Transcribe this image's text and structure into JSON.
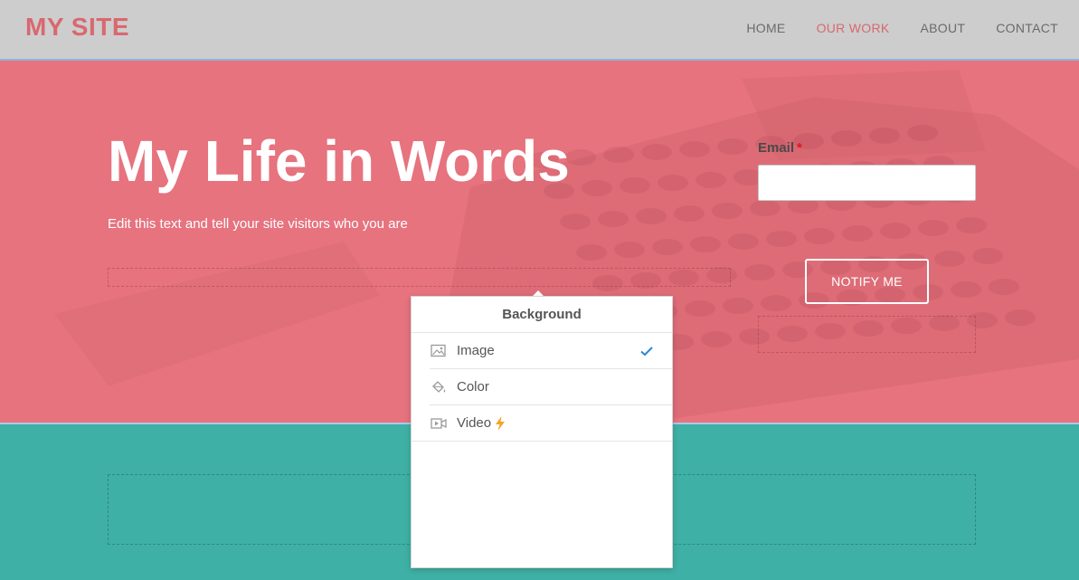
{
  "site": {
    "logo": "MY SITE"
  },
  "nav": {
    "items": [
      {
        "label": "HOME",
        "active": false
      },
      {
        "label": "OUR WORK",
        "active": true
      },
      {
        "label": "ABOUT",
        "active": false
      },
      {
        "label": "CONTACT",
        "active": false
      }
    ]
  },
  "hero": {
    "title": "My Life in Words",
    "subtitle": "Edit this text and tell your site visitors who you are",
    "background_color": "#e6737e"
  },
  "form": {
    "email_label": "Email",
    "required_mark": "*",
    "email_value": "",
    "button_label": "NOTIFY ME"
  },
  "background_menu": {
    "title": "Background",
    "options": [
      {
        "label": "Image",
        "icon": "image-icon",
        "selected": true
      },
      {
        "label": "Color",
        "icon": "paint-bucket-icon",
        "selected": false
      },
      {
        "label": "Video",
        "icon": "video-icon",
        "selected": false,
        "badge": "lightning-icon"
      }
    ]
  },
  "colors": {
    "accent": "#d9686f",
    "teal": "#3fb0a5",
    "check": "#2b87d1",
    "bolt": "#f2a524"
  }
}
